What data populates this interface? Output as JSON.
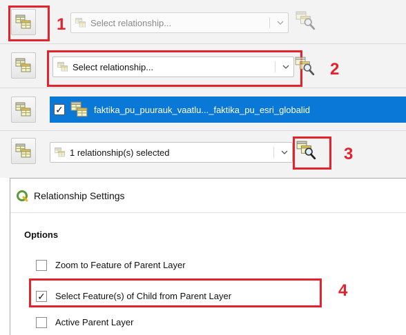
{
  "step1": {
    "combo_placeholder": "Select relationship...",
    "step_number": "1"
  },
  "step2": {
    "combo_value": "Select relationship...",
    "step_number": "2"
  },
  "layer_row": {
    "checked": true,
    "layer_name": "faktika_pu_puurauk_vaatlu..._faktika_pu_esri_globalid"
  },
  "step3": {
    "combo_value": "1 relationship(s) selected",
    "step_number": "3"
  },
  "settings": {
    "title": "Relationship Settings",
    "section": "Options",
    "options": [
      {
        "label": "Zoom to Feature of Parent Layer",
        "checked": false
      },
      {
        "label": "Select Feature(s) of Child from Parent Layer",
        "checked": true
      },
      {
        "label": "Active Parent Layer",
        "checked": false
      }
    ],
    "step_number": "4"
  },
  "colors": {
    "accent_red": "#e3222b",
    "selection_blue": "#0a78d7",
    "qgis_green": "#5d9b3a"
  }
}
